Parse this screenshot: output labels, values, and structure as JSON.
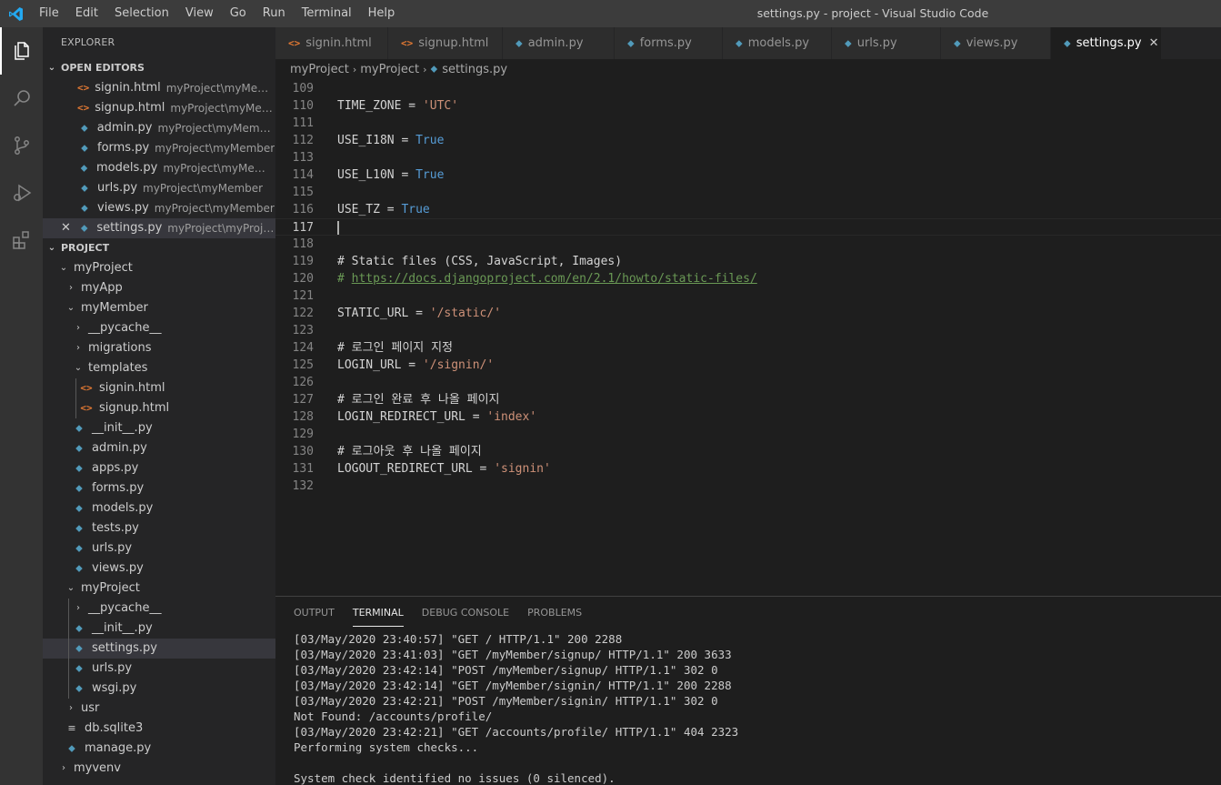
{
  "app": {
    "window_title": "settings.py - project - Visual Studio Code",
    "menu": [
      "File",
      "Edit",
      "Selection",
      "View",
      "Go",
      "Run",
      "Terminal",
      "Help"
    ]
  },
  "activity_bar": [
    "explorer-icon",
    "search-icon",
    "source-control-icon",
    "run-debug-icon",
    "extensions-icon"
  ],
  "sidebar": {
    "title": "EXPLORER",
    "open_editors_label": "OPEN EDITORS",
    "open_editors": [
      {
        "name": "signin.html",
        "path": "myProject\\myMember\\...",
        "type": "html"
      },
      {
        "name": "signup.html",
        "path": "myProject\\myMember...",
        "type": "html"
      },
      {
        "name": "admin.py",
        "path": "myProject\\myMember",
        "type": "py"
      },
      {
        "name": "forms.py",
        "path": "myProject\\myMember",
        "type": "py"
      },
      {
        "name": "models.py",
        "path": "myProject\\myMember",
        "type": "py"
      },
      {
        "name": "urls.py",
        "path": "myProject\\myMember",
        "type": "py"
      },
      {
        "name": "views.py",
        "path": "myProject\\myMember",
        "type": "py"
      },
      {
        "name": "settings.py",
        "path": "myProject\\myProject",
        "type": "py"
      }
    ],
    "project_label": "PROJECT",
    "tree": {
      "root": "myProject",
      "myApp": "myApp",
      "myMember": "myMember",
      "pycache": "__pycache__",
      "migrations": "migrations",
      "templates": "templates",
      "signin": "signin.html",
      "signup": "signup.html",
      "member_init": "__init__.py",
      "admin": "admin.py",
      "apps": "apps.py",
      "forms": "forms.py",
      "models": "models.py",
      "tests": "tests.py",
      "urls": "urls.py",
      "views": "views.py",
      "myProject": "myProject",
      "proj_pycache": "__pycache__",
      "proj_init": "__init__.py",
      "settings": "settings.py",
      "proj_urls": "urls.py",
      "wsgi": "wsgi.py",
      "usr": "usr",
      "db": "db.sqlite3",
      "manage": "manage.py",
      "myvenv": "myvenv"
    }
  },
  "tabs": [
    {
      "label": "signin.html",
      "type": "html"
    },
    {
      "label": "signup.html",
      "type": "html"
    },
    {
      "label": "admin.py",
      "type": "py"
    },
    {
      "label": "forms.py",
      "type": "py"
    },
    {
      "label": "models.py",
      "type": "py"
    },
    {
      "label": "urls.py",
      "type": "py"
    },
    {
      "label": "views.py",
      "type": "py"
    },
    {
      "label": "settings.py",
      "type": "py"
    }
  ],
  "breadcrumb": [
    "myProject",
    "myProject",
    "settings.py"
  ],
  "editor": {
    "line_numbers": [
      "109",
      "110",
      "111",
      "112",
      "113",
      "114",
      "115",
      "116",
      "117",
      "118",
      "119",
      "120",
      "121",
      "122",
      "123",
      "124",
      "125",
      "126",
      "127",
      "128",
      "129",
      "130",
      "131",
      "132"
    ],
    "code": {
      "tz_var": "TIME_ZONE = ",
      "tz_val": "'UTC'",
      "i18n_var": "USE_I18N = ",
      "i18n_val": "True",
      "l10n_var": "USE_L10N = ",
      "l10n_val": "True",
      "usetz_var": "USE_TZ = ",
      "usetz_val": "True",
      "static_comment": "# Static files (CSS, JavaScript, Images)",
      "url_comment_prefix": "# ",
      "url_comment_link": "https://docs.djangoproject.com/en/2.1/howto/static-files/",
      "static_url_var": "STATIC_URL = ",
      "static_url_val": "'/static/'",
      "login_comment": "# 로그인 페이지 지정",
      "login_url_var": "LOGIN_URL = ",
      "login_url_val": "'/signin/'",
      "login_done_comment": "# 로그인 완료 후 나올 페이지",
      "login_redirect_var": "LOGIN_REDIRECT_URL = ",
      "login_redirect_val": "'index'",
      "logout_comment": "# 로그아웃 후 나올 페이지",
      "logout_redirect_var": "LOGOUT_REDIRECT_URL = ",
      "logout_redirect_val": "'signin'"
    }
  },
  "panel": {
    "tabs": [
      "OUTPUT",
      "TERMINAL",
      "DEBUG CONSOLE",
      "PROBLEMS"
    ],
    "active_tab": "TERMINAL",
    "terminal_lines": [
      "[03/May/2020 23:40:57] \"GET / HTTP/1.1\" 200 2288",
      "[03/May/2020 23:41:03] \"GET /myMember/signup/ HTTP/1.1\" 200 3633",
      "[03/May/2020 23:42:14] \"POST /myMember/signup/ HTTP/1.1\" 302 0",
      "[03/May/2020 23:42:14] \"GET /myMember/signin/ HTTP/1.1\" 200 2288",
      "[03/May/2020 23:42:21] \"POST /myMember/signin/ HTTP/1.1\" 302 0",
      "Not Found: /accounts/profile/",
      "[03/May/2020 23:42:21] \"GET /accounts/profile/ HTTP/1.1\" 404 2323",
      "Performing system checks...",
      "",
      "System check identified no issues (0 silenced)."
    ]
  },
  "colors": {
    "accent": "#007acc",
    "keyword": "#569cd6",
    "string": "#ce9178",
    "comment": "#6a9955",
    "html_icon": "#e37933",
    "py_icon": "#519aba"
  }
}
